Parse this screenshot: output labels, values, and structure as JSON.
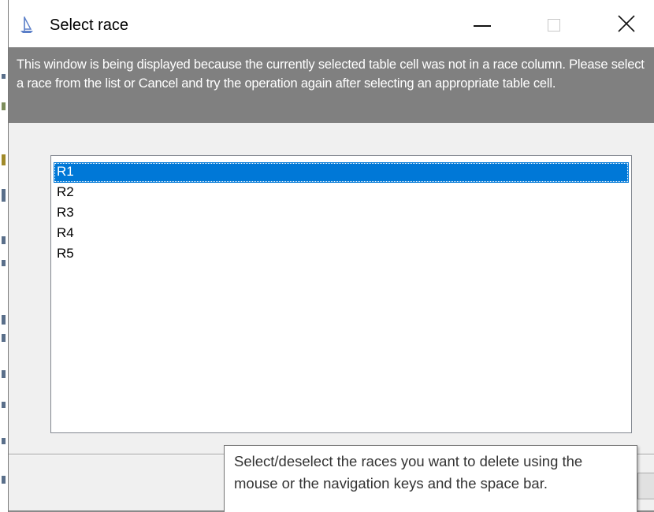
{
  "window": {
    "title": "Select race",
    "icon": "sailboat-icon"
  },
  "banner": {
    "message": "This window is being displayed because the currently selected table cell was not in a race column.  Please select a race from the list or Cancel and try the operation again after selecting an appropriate table cell."
  },
  "race_list": {
    "items": [
      "R1",
      "R2",
      "R3",
      "R4",
      "R5"
    ],
    "selected": "R1"
  },
  "tooltip": {
    "text": "Select/deselect the races you want to delete using the mouse or the navigation keys and the space bar."
  },
  "colors": {
    "selection": "#0078d7",
    "banner_background": "#808080",
    "banner_text": "#ffffff",
    "icon_accent": "#5b7fc8"
  }
}
